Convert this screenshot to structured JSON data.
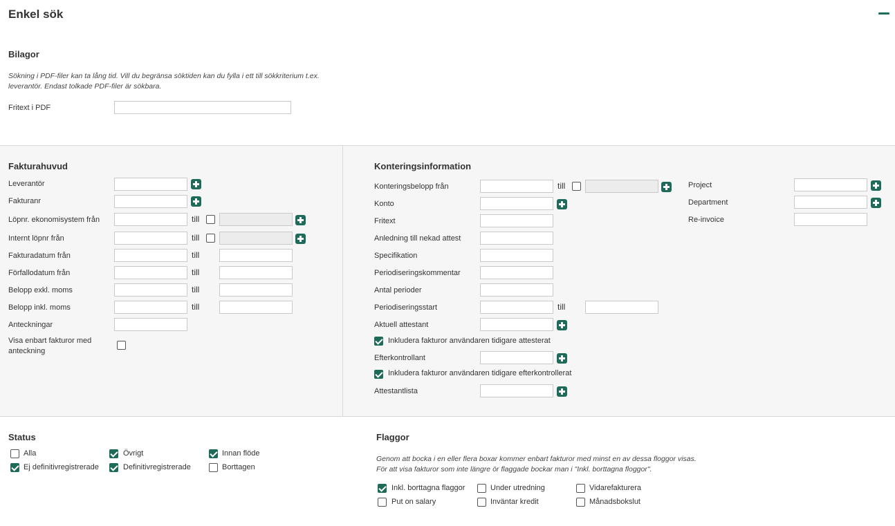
{
  "page_title": "Enkel sök",
  "colors": {
    "accent": "#1d6b58",
    "panel_bg": "#f6f6f6",
    "border": "#c9c9c9"
  },
  "bilagor": {
    "title": "Bilagor",
    "note_line1": "Sökning i PDF-filer kan ta lång tid. Vill du begränsa söktiden kan du fylla i ett till sökkriterium t.ex.",
    "note_line2": "leverantör. Endast tolkade PDF-filer är sökbara.",
    "fritext_label": "Fritext i PDF",
    "fritext_value": ""
  },
  "till": "till",
  "fakturahuvud": {
    "title": "Fakturahuvud",
    "leverantor": "Leverantör",
    "fakturanr": "Fakturanr",
    "lopnr": "Löpnr. ekonomisystem från",
    "internt": "Internt löpnr från",
    "fakturadatum": "Fakturadatum från",
    "forfallodatum": "Förfallodatum från",
    "belopp_exkl": "Belopp exkl. moms",
    "belopp_inkl": "Belopp inkl. moms",
    "anteckningar": "Anteckningar",
    "visa_line1": "Visa enbart fakturor med",
    "visa_line2": "anteckning"
  },
  "kontering": {
    "title": "Konteringsinformation",
    "belopp": "Konteringsbelopp från",
    "konto": "Konto",
    "fritext": "Fritext",
    "anledning": "Anledning till nekad attest",
    "specifikation": "Specifikation",
    "periodkommentar": "Periodiseringskommentar",
    "antal": "Antal perioder",
    "periodstart": "Periodiseringsstart",
    "attestant": "Aktuell attestant",
    "inkl_attesterat": "Inkludera fakturor användaren tidigare attesterat",
    "efterkontrollant": "Efterkontrollant",
    "inkl_efterkontrollerat": "Inkludera fakturor användaren tidigare efterkontrollerat",
    "attestantlista": "Attestantlista",
    "project": "Project",
    "department": "Department",
    "reinvoice": "Re-invoice"
  },
  "status": {
    "title": "Status",
    "alla": "Alla",
    "ovrigt": "Övrigt",
    "innan_flode": "Innan flöde",
    "ej_def": "Ej definitivregistrerade",
    "def": "Definitivregistrerade",
    "borttagen": "Borttagen"
  },
  "flaggor": {
    "title": "Flaggor",
    "note_line1": "Genom att bocka i en eller flera boxar kommer enbart fakturor med minst en av dessa floggor visas.",
    "note_line2": "För att visa fakturor som inte längre ör flaggade bockar man i \"Inkl. borttagna floggor\".",
    "inkl_borttagna": "Inkl. borttagna flaggor",
    "under_utredning": "Under utredning",
    "vidarefakturera": "Vidarefakturera",
    "put_on_salary": "Put on salary",
    "invantar_kredit": "Inväntar kredit",
    "manadsbokslut": "Månadsbokslut"
  }
}
